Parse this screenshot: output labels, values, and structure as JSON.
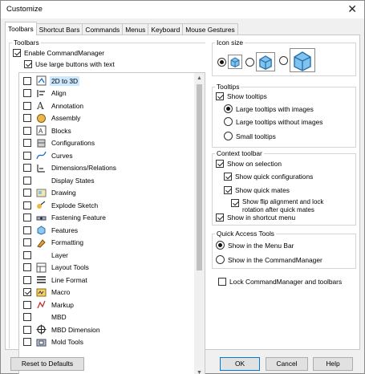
{
  "window": {
    "title": "Customize",
    "close_glyph": "✕"
  },
  "tabs": [
    "Toolbars",
    "Shortcut Bars",
    "Commands",
    "Menus",
    "Keyboard",
    "Mouse Gestures"
  ],
  "toolbars_group": {
    "title": "Toolbars",
    "enable_commandmanager": "Enable CommandManager",
    "use_large_buttons": "Use large buttons with text"
  },
  "toolbar_list": [
    {
      "label": "2D to 3D",
      "checked": false,
      "selected": true,
      "icon": "2d-to-3d-icon"
    },
    {
      "label": "Align",
      "checked": false,
      "icon": "align-icon"
    },
    {
      "label": "Annotation",
      "checked": false,
      "icon": "annotation-icon"
    },
    {
      "label": "Assembly",
      "checked": false,
      "icon": "assembly-icon"
    },
    {
      "label": "Blocks",
      "checked": false,
      "icon": "blocks-icon"
    },
    {
      "label": "Configurations",
      "checked": false,
      "icon": "configurations-icon"
    },
    {
      "label": "Curves",
      "checked": false,
      "icon": "curves-icon"
    },
    {
      "label": "Dimensions/Relations",
      "checked": false,
      "icon": "dimensions-icon"
    },
    {
      "label": "Display States",
      "checked": false,
      "icon": ""
    },
    {
      "label": "Drawing",
      "checked": false,
      "icon": "drawing-icon"
    },
    {
      "label": "Explode Sketch",
      "checked": false,
      "icon": "explode-sketch-icon"
    },
    {
      "label": "Fastening Feature",
      "checked": false,
      "icon": "fastening-feature-icon"
    },
    {
      "label": "Features",
      "checked": false,
      "icon": "features-icon"
    },
    {
      "label": "Formatting",
      "checked": false,
      "icon": "formatting-icon"
    },
    {
      "label": "Layer",
      "checked": false,
      "icon": ""
    },
    {
      "label": "Layout Tools",
      "checked": false,
      "icon": "layout-tools-icon"
    },
    {
      "label": "Line Format",
      "checked": false,
      "icon": "line-format-icon"
    },
    {
      "label": "Macro",
      "checked": true,
      "icon": "macro-icon"
    },
    {
      "label": "Markup",
      "checked": false,
      "icon": "markup-icon"
    },
    {
      "label": "MBD",
      "checked": false,
      "icon": ""
    },
    {
      "label": "MBD Dimension",
      "checked": false,
      "icon": "mbd-dimension-icon"
    },
    {
      "label": "Mold Tools",
      "checked": false,
      "icon": "mold-tools-icon"
    }
  ],
  "icon_size": {
    "title": "Icon size"
  },
  "tooltips": {
    "title": "Tooltips",
    "show_tooltips": "Show tooltips",
    "large_with_images": "Large tooltips with images",
    "large_without_images": "Large tooltips without images",
    "small": "Small tooltips"
  },
  "context_toolbar": {
    "title": "Context toolbar",
    "show_on_selection": "Show on selection",
    "show_quick_configurations": "Show quick configurations",
    "show_quick_mates": "Show quick mates",
    "show_flip_line1": "Show flip alignment and lock",
    "show_flip_line2": "rotation after quick mates",
    "show_in_shortcut_menu": "Show in shortcut menu"
  },
  "quick_access": {
    "title": "Quick Access Tools",
    "menu_bar": "Show in the Menu Bar",
    "commandmanager": "Show in the CommandManager"
  },
  "lock_label": "Lock CommandManager and toolbars",
  "buttons": {
    "reset": "Reset to Defaults",
    "ok": "OK",
    "cancel": "Cancel",
    "help": "Help"
  },
  "colors": {
    "accent": "#0078d7",
    "selection": "#cce8ff"
  }
}
